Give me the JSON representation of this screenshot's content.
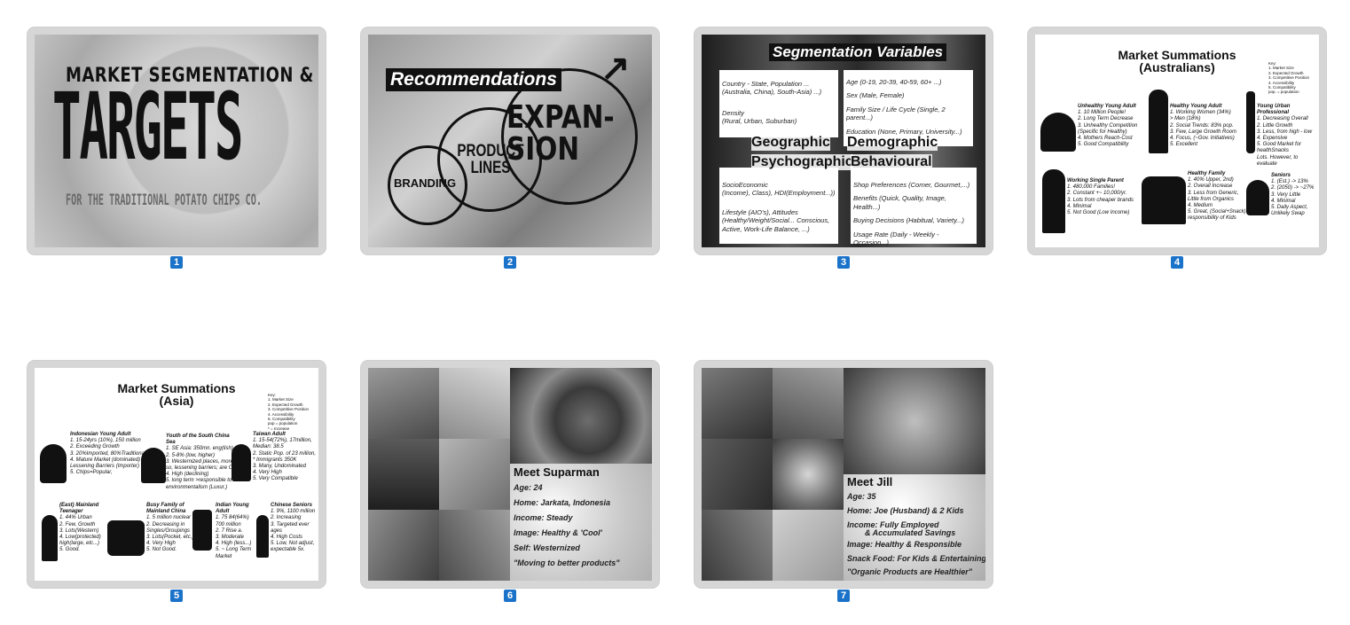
{
  "slides": [
    {
      "number": "1",
      "title_line1": "MARKET SEGMENTATION &",
      "title_big": "TARGETS",
      "subtitle": "FOR THE TRADITIONAL POTATO CHIPS CO."
    },
    {
      "number": "2",
      "title": "Recommendations",
      "circle_branding": "BRANDING",
      "circle_product": "PRODUCT LINES",
      "circle_expansion": "EXPAN-SION"
    },
    {
      "number": "3",
      "title": "Segmentation Variables",
      "geo_line1": "Country - State, Population ...",
      "geo_line2": "(Australia, China), South-Asia) ...)",
      "geo_line3": "Density",
      "geo_line4": "(Rural, Urban, Suburban)",
      "demo_line1": "Age (0-19, 20-39, 40-59, 60+ ...)",
      "demo_line2": "Sex (Male, Female)",
      "demo_line3": "Family Size / Life Cycle (Single, 2 parent...)",
      "demo_line4": "Education (None, Primary, University...)",
      "label_geographic": "Geographic",
      "label_demographic": "Demographic",
      "label_psychographic": "Psychographic",
      "label_behavioural": "Behavioural",
      "psy_line1": "SocioEconomic",
      "psy_line2": "(Income), Class), HDI(Employment...))",
      "psy_line3": "Lifestyle (AIO's), Attitudes",
      "psy_line4": "(Healthy/Weight/Social... Conscious,",
      "psy_line5": "Active, Work-Life Balance, ...)",
      "beh_line1": "Shop Preferences (Corner, Gourmet,...)",
      "beh_line2": "Benefits (Quick, Quality, Image, Health...)",
      "beh_line3": "Buying Decisions (Habitual, Variety...)",
      "beh_line4": "Usage Rate (Daily - Weekly - Occasion...)"
    },
    {
      "number": "4",
      "title_line1": "Market Summations",
      "title_line2": "(Australians)",
      "key": [
        "Key:",
        "1. Market Size",
        "2. Expected Growth",
        "3. Competitive Position",
        "4. Accessibility",
        "5. Compatibility",
        "pop. = population"
      ],
      "seg1_title": "Unhealthy Young Adult",
      "seg1_lines": [
        "1. 10 Million People!",
        "2. Long Term Decrease",
        "3. Unhealthy Competition",
        "(Specific for Healthy)",
        "4. Mothers Reach-Cost",
        "5. Good Compatibility"
      ],
      "seg2_title": "Healthy Young Adult",
      "seg2_lines": [
        "1. Working Women (34%)",
        "> Men (18%)",
        "2. Social Trends: 83% pop.",
        "3. Few, Large Growth Room",
        "4. Focus, (~Gov. Initiatives)",
        "5. Excellent"
      ],
      "seg3_title": "Young Urban Professional",
      "seg3_lines": [
        "1. Decreasing Overall",
        "2. Little Growth",
        "3. Less, from high - low",
        "4. Expensive",
        "5. Good Market for healthSnacks",
        "Lots. However, to evaluate"
      ],
      "seg4_title": "Working Single Parent",
      "seg4_lines": [
        "1. 480,000 Families!",
        "2. Constant +~ 10,000/yr.",
        "3. Lots from cheaper brands",
        "4. Minimal",
        "5. Not Good (Low Income)"
      ],
      "seg5_title": "Healthy Family",
      "seg5_lines": [
        "1. 40% Upper, 2nd)",
        "2. Overall Increase",
        "3. Less from Generic,",
        "Little from Organics",
        "4. Medium",
        "5. Great, (Social+Snack)",
        "responsibility of Kids"
      ],
      "seg6_title": "Seniors",
      "seg6_lines": [
        "1. (Est.) -> 13%",
        "2. (2050) -> ~27%",
        "3. Very Little",
        "4. Minimal",
        "5. Daily Aspect,",
        "Unlikely Swap"
      ]
    },
    {
      "number": "5",
      "title_line1": "Market Summations",
      "title_line2": "(Asia)",
      "key": [
        "Key:",
        "1. Market Size",
        "2. Expected Growth",
        "3. Competitive Position",
        "4. Accessibility",
        "5. Compatibility",
        "pop = population",
        "* = Increase"
      ],
      "seg1_title": "Indonesian Young Adult",
      "seg1_lines": [
        "1. 15-24yrs (10%), 150 million",
        "2. Exceeding Growth",
        "3. 20%Imported, 80%Traditional",
        "4. Mature Market (dominated)",
        "Lessening Barriers (Importer)",
        "5. Chips=Popular,"
      ],
      "seg2_title": "Youth of the South China Sea",
      "seg2_lines": [
        "1. SE Asia: 350mn. eng(lish)",
        "2. 5-8% (low, higher)",
        "3. Westernized places, more",
        "so, lessening barriers; are Or",
        "4. High (declining)",
        "5. long term >responsible to",
        "environmentalism (Luxur.)"
      ],
      "seg3_title": "Taiwan Adult",
      "seg3_lines": [
        "1. 15-54(72%), 17million,",
        "Median: 38.5",
        "2. Static Pop. of 23 million,",
        "* Immigrants 350K",
        "3. Many, Undominated",
        "4. Very High",
        "5. Very Compatible"
      ],
      "seg4_title": "(East) Mainland Teenager",
      "seg4_lines": [
        "1. 44% Urban",
        "2. Few, Growth",
        "3. Lots(Western)",
        "4. Low(protected)",
        "high(large, etc...)",
        "5. Good."
      ],
      "seg5_title": "Busy Family of Mainland China",
      "seg5_lines": [
        "1. 5 million nuclear",
        "2. Decreasing in",
        "Singles/Groupings",
        "3. Lots(Pocket, etc.)",
        "4. Very High",
        "5. Not Good."
      ],
      "seg6_title": "Indian Young Adult",
      "seg6_lines": [
        "1. 75 84(64%)",
        "700 million",
        "2. 7 Rise a.",
        "3. Moderate",
        "4. High (less...)",
        "5. ~ Long Term",
        "Market"
      ],
      "seg7_title": "Chinese Seniors",
      "seg7_lines": [
        "1. 9%, 1100 million",
        "2. Increasing",
        "3. Targeted ever",
        "ages",
        "4. High Costs",
        "5. Low, Not adjust,",
        "expectable 5x."
      ]
    },
    {
      "number": "6",
      "name": "Meet Suparman",
      "age": "Age: 24",
      "home": "Home: Jarkata, Indonesia",
      "income": "Income: Steady",
      "image": "Image: Healthy & 'Cool'",
      "self": "Self: Westernized",
      "quote": "\"Moving to better products\""
    },
    {
      "number": "7",
      "name": "Meet Jill",
      "age": "Age: 35",
      "home": "Home: Joe (Husband) & 2 Kids",
      "income_line1": "Income: Fully Employed",
      "income_line2": "& Accumulated Savings",
      "image": "Image: Healthy & Responsible",
      "snack": "Snack Food: For Kids & Entertaining",
      "quote": "\"Organic Products are Healthier\""
    }
  ],
  "colors": {
    "badge": "#1b72c9",
    "frame": "#d6d6d6"
  }
}
